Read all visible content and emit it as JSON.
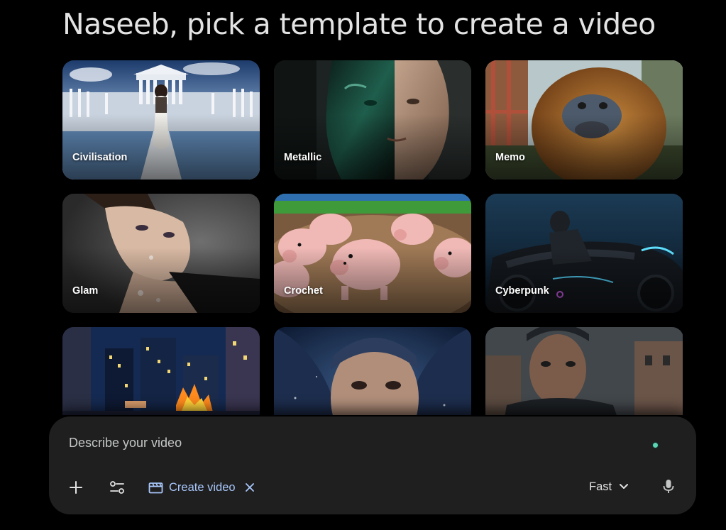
{
  "header": {
    "title": "Naseeb, pick a template to create a video"
  },
  "templates": [
    {
      "label": "Civilisation",
      "icon": "civilisation-thumbnail"
    },
    {
      "label": "Metallic",
      "icon": "metallic-thumbnail"
    },
    {
      "label": "Memo",
      "icon": "memo-thumbnail"
    },
    {
      "label": "Glam",
      "icon": "glam-thumbnail"
    },
    {
      "label": "Crochet",
      "icon": "crochet-thumbnail"
    },
    {
      "label": "Cyberpunk",
      "icon": "cyberpunk-thumbnail"
    },
    {
      "label": "",
      "icon": "pixel-city-thumbnail"
    },
    {
      "label": "",
      "icon": "cosmic-portrait-thumbnail"
    },
    {
      "label": "",
      "icon": "action-hero-thumbnail"
    }
  ],
  "composer": {
    "placeholder": "Describe your video",
    "add_icon": "plus-icon",
    "tools_icon": "tune-icon",
    "tool_chip": {
      "label": "Create video",
      "icon": "video-clapper-icon",
      "close_icon": "close-icon"
    },
    "mode": {
      "selected": "Fast",
      "icon": "chevron-down-icon"
    },
    "mic_icon": "microphone-icon",
    "status_color": "#5fd4b4"
  },
  "colors": {
    "background": "#000000",
    "composer_bg": "#1f1f20",
    "accent": "#a8c7fa",
    "text": "#e3e3e3"
  }
}
